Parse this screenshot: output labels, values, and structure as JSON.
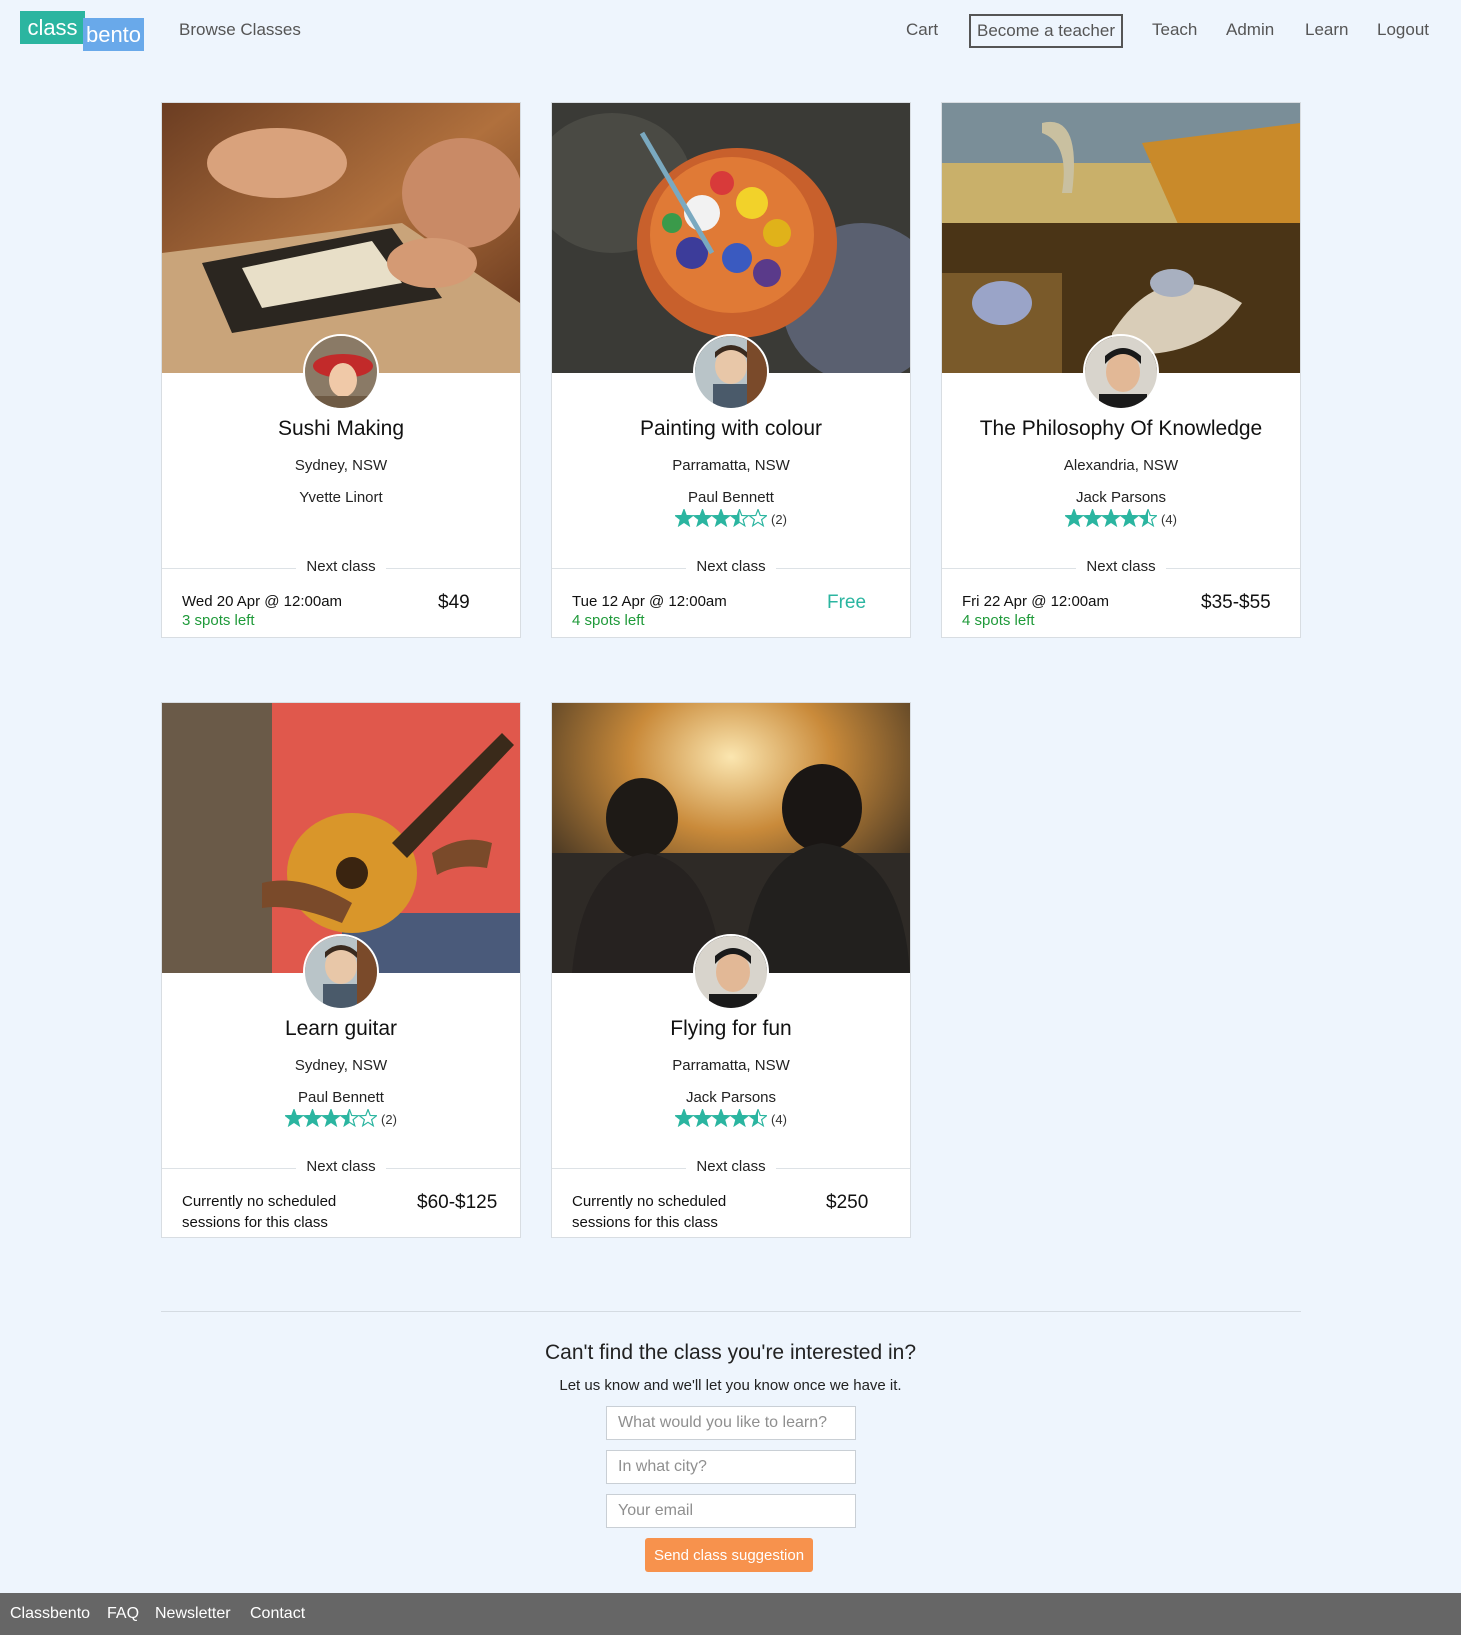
{
  "brand": {
    "logo_class": "class",
    "logo_bento": "bento"
  },
  "nav": {
    "browse": "Browse Classes",
    "cart": "Cart",
    "become_teacher": "Become a teacher",
    "teach": "Teach",
    "admin": "Admin",
    "learn": "Learn",
    "logout": "Logout"
  },
  "accent_colors": {
    "teal": "#2bb5a0",
    "blue": "#69a9ea",
    "green": "#1f9a3a",
    "orange": "#f7924d",
    "footer": "#666666"
  },
  "classes": [
    {
      "title": "Sushi Making",
      "location": "Sydney, NSW",
      "teacher": "Yvette Linort",
      "rating": null,
      "review_count": "",
      "next_label": "Next class",
      "session": "Wed 20 Apr @ 12:00am",
      "spots": "3 spots left",
      "price": "$49"
    },
    {
      "title": "Painting with colour",
      "location": "Parramatta, NSW",
      "teacher": "Paul Bennett",
      "rating": 3.5,
      "review_count": "(2)",
      "next_label": "Next class",
      "session": "Tue 12 Apr @ 12:00am",
      "spots": "4 spots left",
      "price": "Free"
    },
    {
      "title": "The Philosophy Of Knowledge",
      "location": "Alexandria, NSW",
      "teacher": "Jack Parsons",
      "rating": 4.5,
      "review_count": "(4)",
      "next_label": "Next class",
      "session": "Fri 22 Apr @ 12:00am",
      "spots": "4 spots left",
      "price": "$35-$55"
    },
    {
      "title": "Learn guitar",
      "location": "Sydney, NSW",
      "teacher": "Paul Bennett",
      "rating": 3.5,
      "review_count": "(2)",
      "next_label": "Next class",
      "session_line1": "Currently no scheduled",
      "session_line2": "sessions for this class",
      "price": "$60-$125"
    },
    {
      "title": "Flying for fun",
      "location": "Parramatta, NSW",
      "teacher": "Jack Parsons",
      "rating": 4.5,
      "review_count": "(4)",
      "next_label": "Next class",
      "session_line1": "Currently no scheduled",
      "session_line2": "sessions for this class",
      "price": "$250"
    }
  ],
  "suggestion": {
    "title": "Can't find the class you're interested in?",
    "subtitle": "Let us know and we'll let you know once we have it.",
    "learn_placeholder": "What would you like to learn?",
    "city_placeholder": "In what city?",
    "email_placeholder": "Your email",
    "button": "Send class suggestion"
  },
  "footer": {
    "classbento": "Classbento",
    "faq": "FAQ",
    "newsletter": "Newsletter",
    "contact": "Contact"
  }
}
